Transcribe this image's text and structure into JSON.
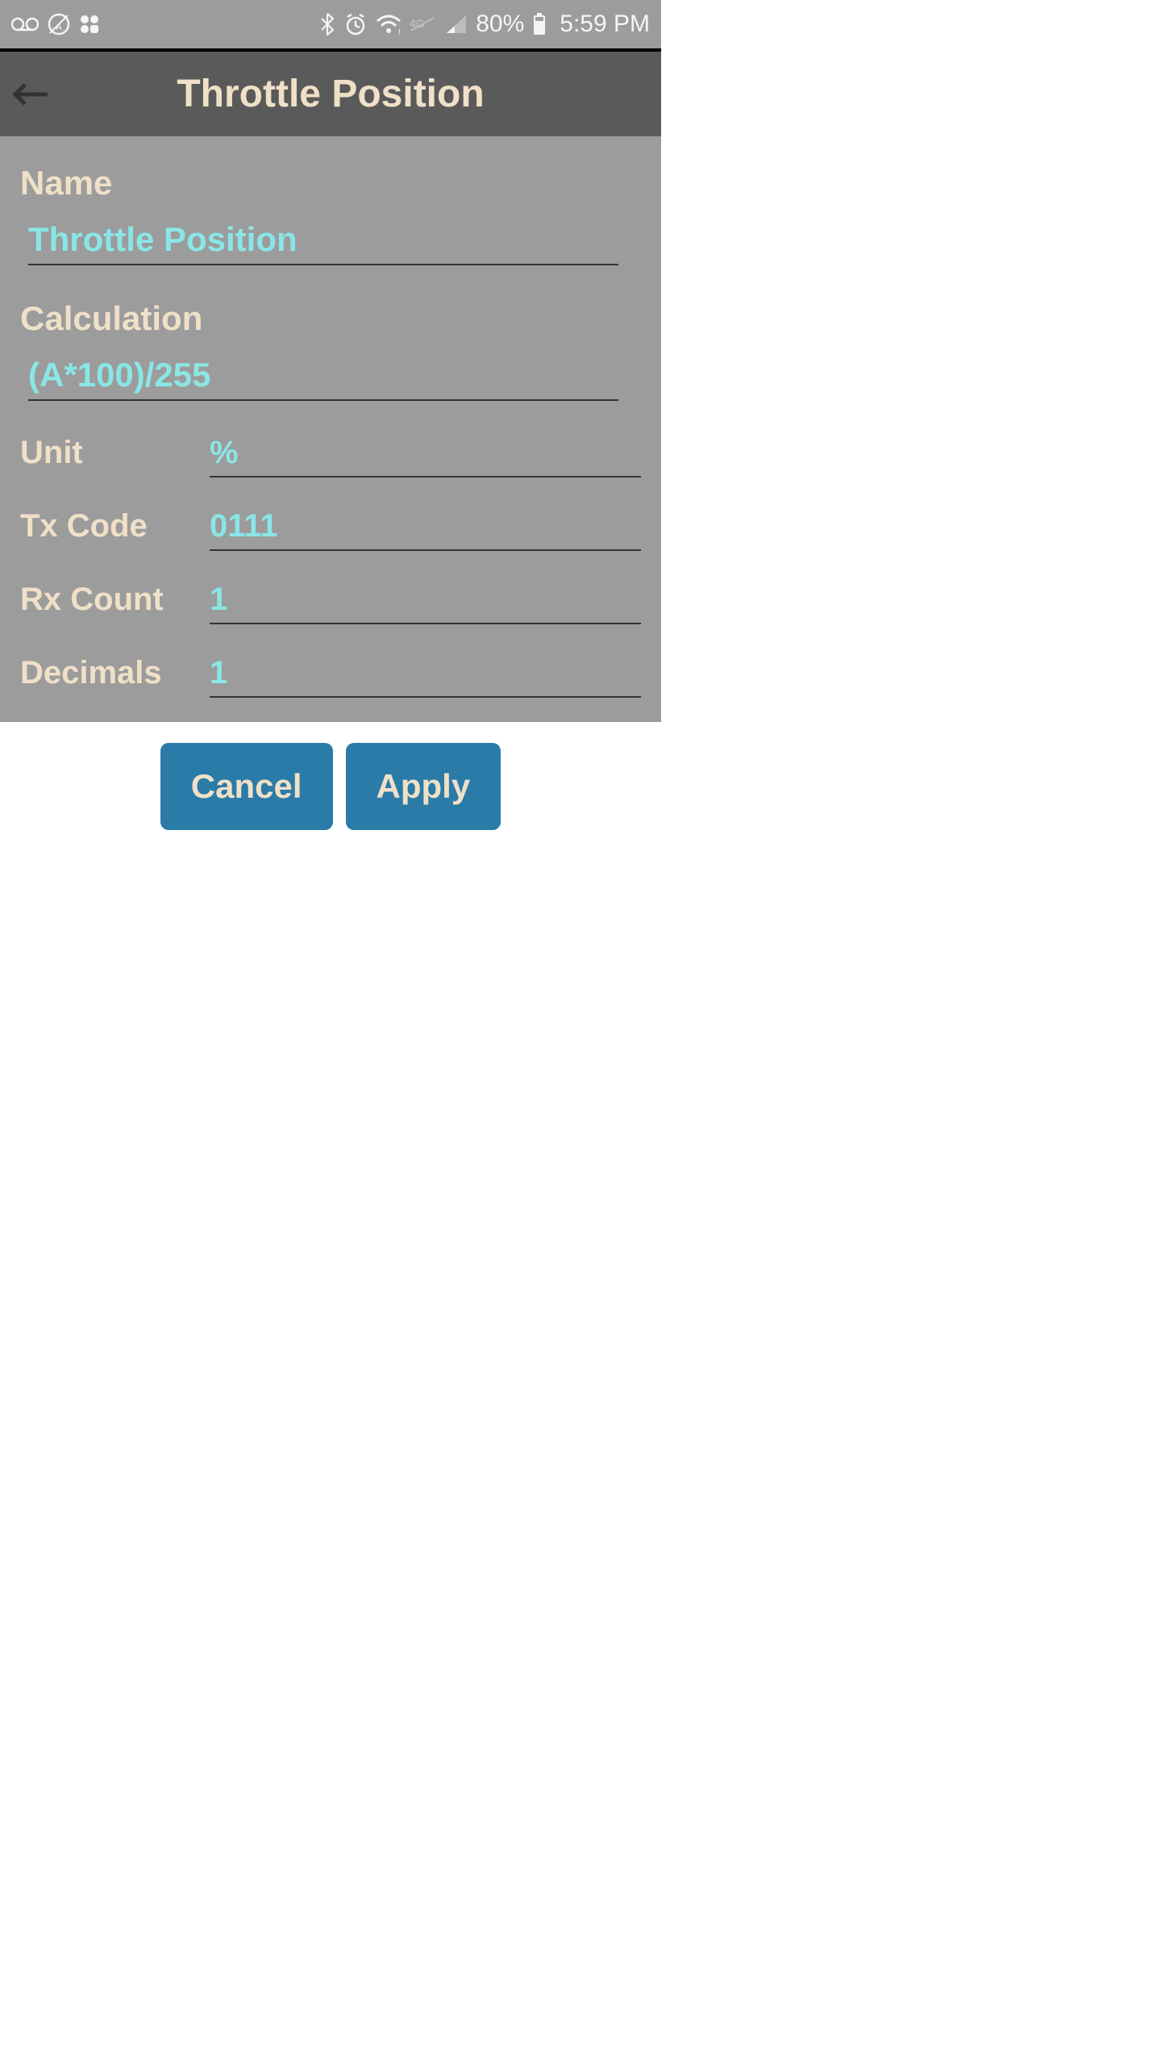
{
  "status_bar": {
    "battery_pct": "80%",
    "time": "5:59 PM"
  },
  "header": {
    "title": "Throttle Position"
  },
  "form": {
    "name_label": "Name",
    "name_value": "Throttle Position",
    "calculation_label": "Calculation",
    "calculation_value": "(A*100)/255",
    "unit_label": "Unit",
    "unit_value": "%",
    "tx_code_label": "Tx Code",
    "tx_code_value": "0111",
    "rx_count_label": "Rx Count",
    "rx_count_value": "1",
    "decimals_label": "Decimals",
    "decimals_value": "1"
  },
  "buttons": {
    "cancel": "Cancel",
    "apply": "Apply"
  }
}
